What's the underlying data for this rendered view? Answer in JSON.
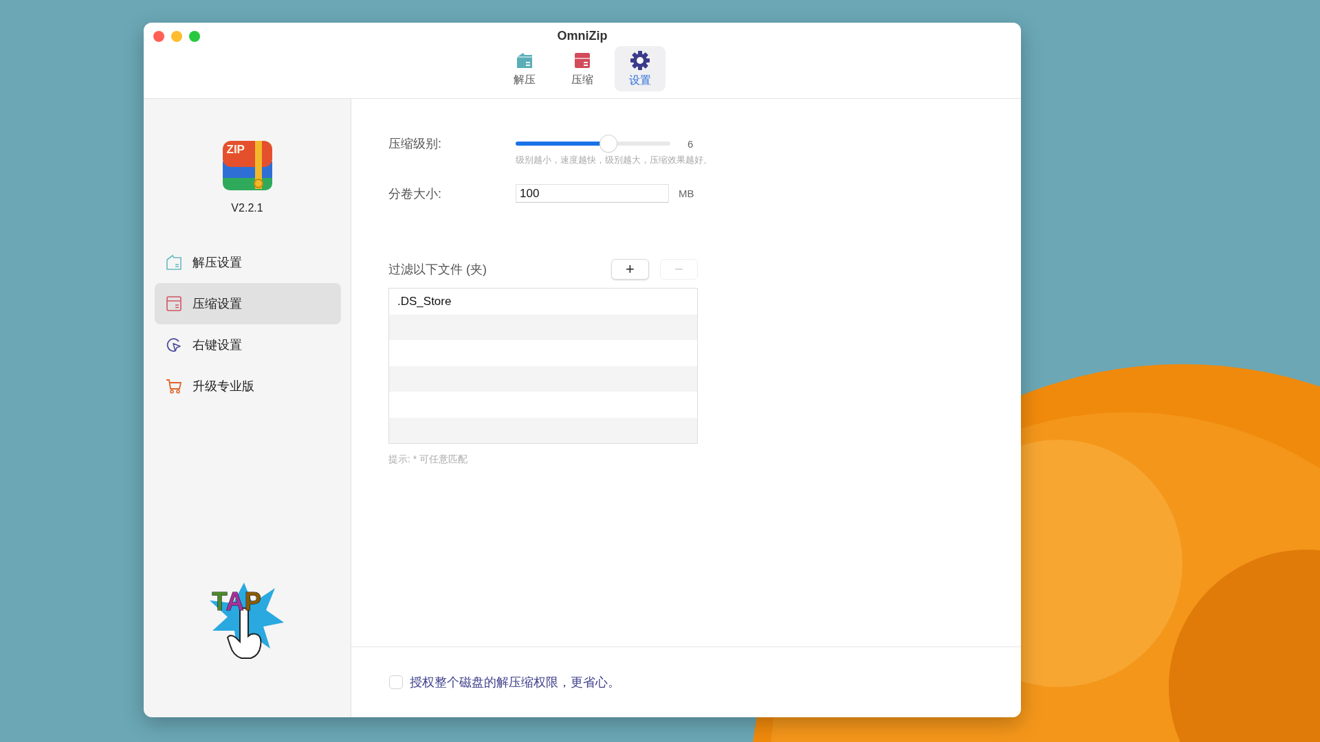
{
  "window": {
    "title": "OmniZip"
  },
  "toolbar": {
    "tabs": [
      {
        "label": "解压",
        "kind": "extract",
        "selected": false
      },
      {
        "label": "压缩",
        "kind": "compress",
        "selected": false
      },
      {
        "label": "设置",
        "kind": "settings",
        "selected": true
      }
    ]
  },
  "sidebar": {
    "app_icon_text": "ZIP",
    "version": "V2.2.1",
    "items": [
      {
        "label": "解压设置",
        "kind": "extract",
        "selected": false
      },
      {
        "label": "压缩设置",
        "kind": "compress",
        "selected": true
      },
      {
        "label": "右键设置",
        "kind": "pointer",
        "selected": false
      },
      {
        "label": "升级专业版",
        "kind": "upgrade",
        "selected": false
      }
    ],
    "promo_text": "TAP"
  },
  "settings": {
    "level_label": "压缩级别:",
    "level": 0.6,
    "level_reading": "6",
    "level_hint": "级别越小，速度越快，级别越大，压缩效果越好。",
    "split_label": "分卷大小:",
    "split_value": "100",
    "split_unit": "MB",
    "filter_label": "过滤以下文件 (夹)",
    "add_button": {
      "label": "+",
      "disabled": false
    },
    "remove_button": {
      "label": "−",
      "disabled": true
    },
    "filter_rows": [
      ".DS_Store"
    ],
    "filter_hint": "提示: * 可任意匹配"
  },
  "permission": {
    "label": "授权整个磁盘的解压缩权限，更省心。",
    "checked": false
  }
}
